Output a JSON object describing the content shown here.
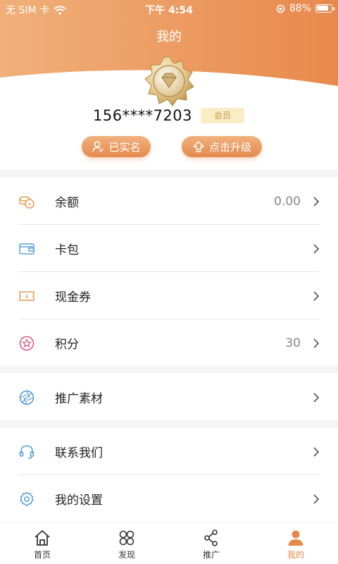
{
  "status": {
    "carrier": "无 SIM 卡",
    "time": "下午 4:54",
    "battery": "88%",
    "battery_level": 0.88
  },
  "header": {
    "title": "我的",
    "phone": "156****7203",
    "member_tag": "会员",
    "verified_label": "已实名",
    "upgrade_label": "点击升级"
  },
  "menu_group_1": [
    {
      "label": "余额",
      "value": "0.00",
      "icon": "coins-icon"
    },
    {
      "label": "卡包",
      "value": "",
      "icon": "wallet-icon"
    },
    {
      "label": "现金券",
      "value": "",
      "icon": "coupon-icon"
    },
    {
      "label": "积分",
      "value": "30",
      "icon": "points-star-icon"
    }
  ],
  "menu_group_2": [
    {
      "label": "推广素材",
      "value": "",
      "icon": "aperture-icon"
    }
  ],
  "menu_group_3": [
    {
      "label": "联系我们",
      "value": "",
      "icon": "headset-icon"
    },
    {
      "label": "我的设置",
      "value": "",
      "icon": "gear-icon"
    }
  ],
  "tabs": [
    {
      "label": "首页",
      "icon": "home-icon",
      "active": false
    },
    {
      "label": "发现",
      "icon": "discover-icon",
      "active": false
    },
    {
      "label": "推广",
      "icon": "share-icon",
      "active": false
    },
    {
      "label": "我的",
      "icon": "user-icon",
      "active": true
    }
  ],
  "colors": {
    "accent": "#e4894c",
    "header_gradient_start": "#f0b07a",
    "header_gradient_end": "#e8894c"
  }
}
